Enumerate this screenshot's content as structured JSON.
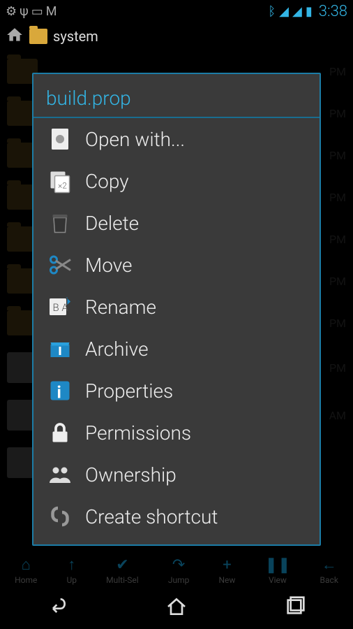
{
  "statusbar": {
    "time": "3:38"
  },
  "header": {
    "path": "system"
  },
  "files": [
    {
      "name": "",
      "time": "PM",
      "type": "folder"
    },
    {
      "name": "",
      "time": "PM",
      "type": "folder"
    },
    {
      "name": "",
      "time": "PM",
      "type": "folder"
    },
    {
      "name": "",
      "time": "PM",
      "type": "folder"
    },
    {
      "name": "",
      "time": "PM",
      "type": "folder"
    },
    {
      "name": "",
      "time": "PM",
      "type": "folder"
    },
    {
      "name": "",
      "time": "PM",
      "type": "folder"
    },
    {
      "name": "",
      "time": "PM",
      "type": "file"
    },
    {
      "name": "",
      "time": "AM",
      "type": "file"
    },
    {
      "name": "",
      "time": "",
      "type": "file"
    }
  ],
  "dialog": {
    "title": "build.prop",
    "items": [
      {
        "label": "Open with...",
        "icon": "open"
      },
      {
        "label": "Copy",
        "icon": "copy"
      },
      {
        "label": "Delete",
        "icon": "delete"
      },
      {
        "label": "Move",
        "icon": "move"
      },
      {
        "label": "Rename",
        "icon": "rename"
      },
      {
        "label": "Archive",
        "icon": "archive"
      },
      {
        "label": "Properties",
        "icon": "info"
      },
      {
        "label": "Permissions",
        "icon": "lock"
      },
      {
        "label": "Ownership",
        "icon": "users"
      },
      {
        "label": "Create shortcut",
        "icon": "shortcut"
      }
    ]
  },
  "toolbar": [
    {
      "label": "Home",
      "icon": "home"
    },
    {
      "label": "Up",
      "icon": "up"
    },
    {
      "label": "Multi-Sel",
      "icon": "check"
    },
    {
      "label": "Jump",
      "icon": "jump"
    },
    {
      "label": "New",
      "icon": "plus"
    },
    {
      "label": "View",
      "icon": "view"
    },
    {
      "label": "Back",
      "icon": "back"
    }
  ]
}
